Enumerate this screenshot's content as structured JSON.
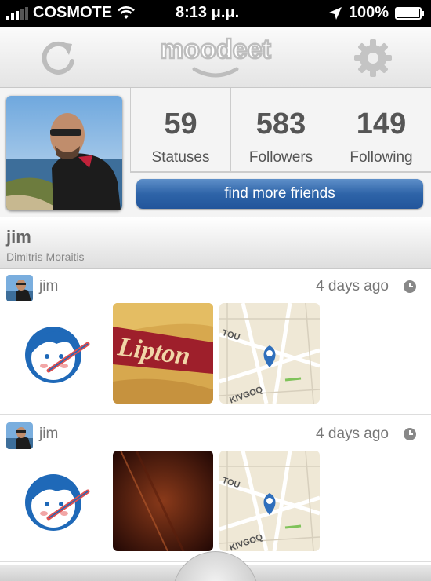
{
  "status_bar": {
    "carrier": "COSMOTE",
    "time": "8:13 μ.μ.",
    "battery": "100%",
    "battery_level": 1.0,
    "icons": [
      "signal-icon",
      "wifi-icon",
      "location-arrow-icon",
      "battery-icon"
    ]
  },
  "navbar": {
    "logo_text": "moodeet",
    "left_icon": "refresh-icon",
    "right_icon": "gear-icon"
  },
  "profile": {
    "stats": [
      {
        "value": "59",
        "label": "Statuses"
      },
      {
        "value": "583",
        "label": "Followers"
      },
      {
        "value": "149",
        "label": "Following"
      }
    ],
    "find_friends_label": "find more friends",
    "username": "jim",
    "full_name": "Dimitris Moraitis"
  },
  "feed": [
    {
      "user": "jim",
      "time": "4 days ago",
      "photo": "lipton-photo",
      "map": "map-thumbnail"
    },
    {
      "user": "jim",
      "time": "4 days ago",
      "photo": "dark-wood-photo",
      "map": "map-thumbnail"
    }
  ],
  "colors": {
    "accent_blue": "#2e64a8",
    "text_gray": "#555555"
  }
}
